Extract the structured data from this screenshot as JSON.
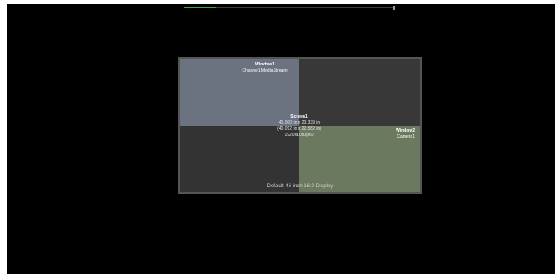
{
  "colors": {
    "canvas_background": "#000000",
    "display_background": "#353535",
    "display_border": "#555555",
    "window1_fill": "#6b7280",
    "window2_fill": "#6b7a5f",
    "slider_accent": "#2fa84a"
  },
  "slider": {
    "position_fraction": 0.15
  },
  "window1": {
    "title": "Window1",
    "source": "Channel1MediaStream"
  },
  "window2": {
    "title": "Window2",
    "source": "Camera1"
  },
  "screen": {
    "title": "Screen1",
    "size_outer": "40.000 in x 23.339 in",
    "size_inner": "(40.092 in x 22.552 in)",
    "resolution": "1920x1080p60"
  },
  "display": {
    "caption": "Default 46 inch 16:9 Display"
  }
}
